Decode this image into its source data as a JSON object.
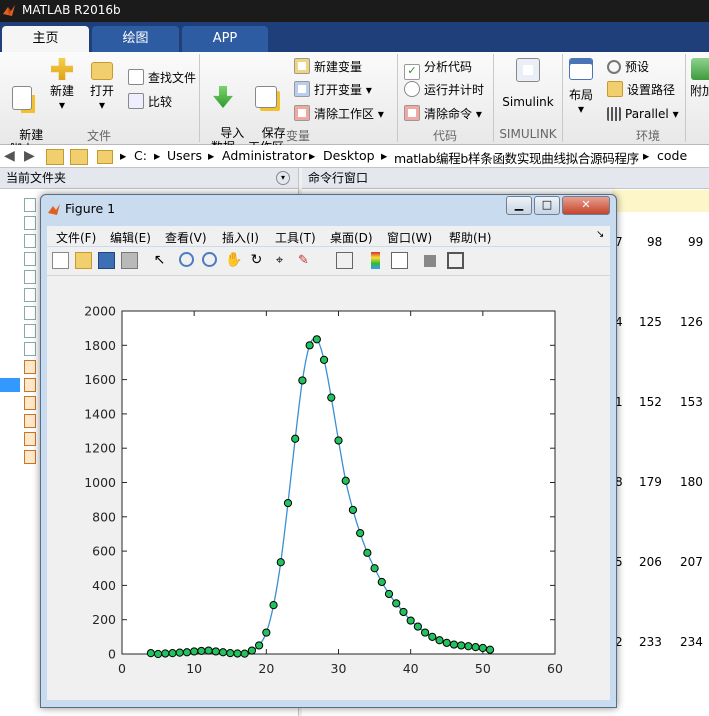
{
  "app": {
    "title": "MATLAB R2016b"
  },
  "tabs": [
    {
      "label": "主页"
    },
    {
      "label": "绘图"
    },
    {
      "label": "APP"
    }
  ],
  "ribbon": {
    "new_script": "新建\n脚本",
    "new": "新建",
    "open": "打开",
    "find_files": "查找文件",
    "compare": "比较",
    "import_data": "导入\n数据",
    "save_workspace": "保存\n工作区",
    "new_variable": "新建变量",
    "open_variable": "打开变量",
    "clear_workspace": "清除工作区",
    "analyze_code": "分析代码",
    "run_and_time": "运行并计时",
    "clear_commands": "清除命令",
    "simulink": "Simulink",
    "layout": "布局",
    "preferences": "预设",
    "set_path": "设置路径",
    "parallel": "Parallel",
    "addons": "附加",
    "sections": {
      "file": "文件",
      "variable": "变量",
      "code": "代码",
      "simulink": "SIMULINK",
      "environment": "环境"
    }
  },
  "address": {
    "crumbs": [
      "C:",
      "Users",
      "Administrator",
      "Desktop",
      "matlab编程b样条函数实现曲线拟合源码程序",
      "code"
    ]
  },
  "panels": {
    "current_folder": "当前文件夹",
    "command_window": "命令行窗口"
  },
  "command_output": {
    "rows": [
      [
        "7",
        "98",
        "99"
      ],
      [
        "4",
        "125",
        "126"
      ],
      [
        "1",
        "152",
        "153"
      ],
      [
        "8",
        "179",
        "180"
      ],
      [
        "5",
        "206",
        "207"
      ],
      [
        "2",
        "233",
        "234"
      ]
    ]
  },
  "figure": {
    "title": "Figure 1",
    "menu": [
      "文件(F)",
      "编辑(E)",
      "查看(V)",
      "插入(I)",
      "工具(T)",
      "桌面(D)",
      "窗口(W)",
      "帮助(H)"
    ],
    "toolbar_icons": [
      "new-figure-icon",
      "open-file-icon",
      "save-icon",
      "print-icon",
      "select-arrow-icon",
      "zoom-in-icon",
      "zoom-out-icon",
      "pan-icon",
      "rotate-3d-icon",
      "data-cursor-icon",
      "brush-icon",
      "link-plot-icon",
      "colorbar-icon",
      "legend-icon",
      "hide-plot-tools-icon",
      "show-plot-tools-icon"
    ],
    "colors": {
      "curve": "#3a8fd3",
      "marker_fill": "#22c35e",
      "marker_edge": "#000000"
    }
  },
  "chart_data": {
    "type": "line",
    "title": "",
    "xlabel": "",
    "ylabel": "",
    "xlim": [
      0,
      60
    ],
    "ylim": [
      0,
      2000
    ],
    "xticks": [
      0,
      10,
      20,
      30,
      40,
      50,
      60
    ],
    "yticks": [
      0,
      200,
      400,
      600,
      800,
      1000,
      1200,
      1400,
      1600,
      1800,
      2000
    ],
    "grid": false,
    "x": [
      4,
      5,
      6,
      7,
      8,
      9,
      10,
      11,
      12,
      13,
      14,
      15,
      16,
      17,
      18,
      19,
      20,
      21,
      22,
      23,
      24,
      25,
      26,
      27,
      28,
      29,
      30,
      31,
      32,
      33,
      34,
      35,
      36,
      37,
      38,
      39,
      40,
      41,
      42,
      43,
      44,
      45,
      46,
      47,
      48,
      49,
      50,
      51
    ],
    "values": [
      5,
      0,
      3,
      5,
      8,
      10,
      15,
      18,
      20,
      15,
      10,
      5,
      3,
      2,
      20,
      50,
      125,
      285,
      535,
      880,
      1255,
      1595,
      1800,
      1835,
      1715,
      1495,
      1245,
      1010,
      840,
      705,
      590,
      500,
      420,
      350,
      295,
      245,
      195,
      160,
      125,
      100,
      80,
      65,
      55,
      50,
      45,
      40,
      35,
      25
    ]
  }
}
